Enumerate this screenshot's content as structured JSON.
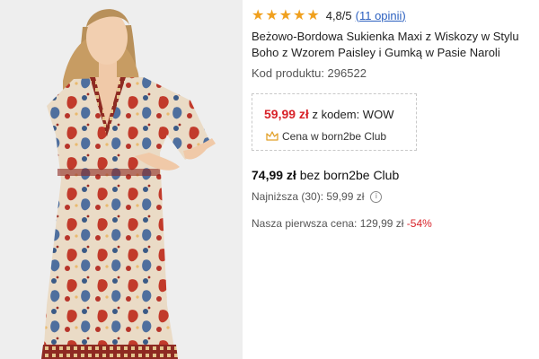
{
  "product": {
    "image_alt": "Model in beige-burgundy paisley boho maxi dress",
    "rating": {
      "stars": 5,
      "score": "4,8/5",
      "reviews_link": "(11 opinii)"
    },
    "title": "Beżowo-Bordowa Sukienka Maxi z Wiskozy w Stylu Boho z Wzorem Paisley i Gumką w Pasie Naroli",
    "code": "Kod produktu: 296522",
    "promo": {
      "price": "59,99 zł",
      "code_label": "z kodem: WOW",
      "club_label": "Cena w born2be Club"
    },
    "regular": {
      "price": "74,99 zł",
      "label": "bez born2be Club"
    },
    "lowest": "Najniższa (30): 59,99 zł",
    "first_price": {
      "label": "Nasza pierwsza cena: 129,99 zł",
      "discount": "-54%"
    }
  },
  "colors": {
    "star": "#f0a01e",
    "promo_price": "#d8232a",
    "link": "#2a5fbf",
    "discount": "#d8232a"
  },
  "icons": [
    "star-icon",
    "club-crown-icon",
    "info-icon"
  ]
}
